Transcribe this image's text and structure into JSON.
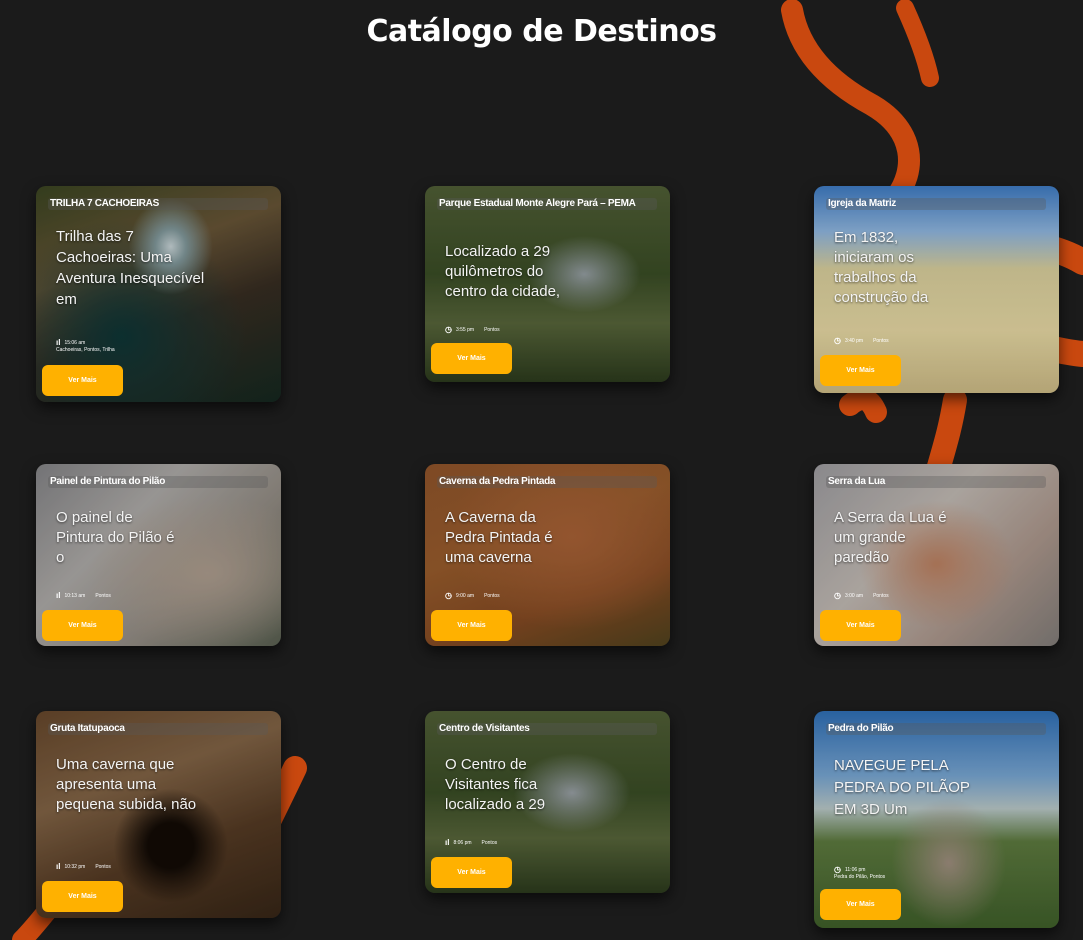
{
  "page": {
    "title": "Catálogo de Destinos"
  },
  "colors": {
    "background": "#1b1b1b",
    "accent_orange": "#c9480f",
    "button": "#ffb100"
  },
  "cards": [
    {
      "title": "TRILHA 7 CACHOEIRAS",
      "description": "Trilha das 7 Cachoeiras: Uma Aventura Inesquecível em",
      "meta_time": "15:06 am",
      "meta_tags": "Cachoeiras, Pontos, Trilha",
      "button": "Ver Mais",
      "icon": "hiker-icon"
    },
    {
      "title": "Parque Estadual Monte Alegre Pará – PEMA",
      "description": "Localizado a 29 quilômetros do centro da cidade,",
      "meta_time": "3:55 pm",
      "meta_tags": "Pontos",
      "button": "Ver Mais",
      "icon": "clock-icon"
    },
    {
      "title": "Igreja da Matriz",
      "description": "Em 1832, iniciaram os trabalhos da construção da",
      "meta_time": "3:40 pm",
      "meta_tags": "Pontos",
      "button": "Ver Mais",
      "icon": "clock-icon"
    },
    {
      "title": "Painel de Pintura do Pilão",
      "description": "O painel de Pintura do Pilão é o",
      "meta_time": "10:13 am",
      "meta_tags": "Pontos",
      "button": "Ver Mais",
      "icon": "hiker-icon"
    },
    {
      "title": "Caverna da Pedra Pintada",
      "description": "A Caverna da Pedra Pintada é uma caverna",
      "meta_time": "9:00 am",
      "meta_tags": "Pontos",
      "button": "Ver Mais",
      "icon": "clock-icon"
    },
    {
      "title": "Serra da Lua",
      "description": "A Serra da Lua é um grande paredão",
      "meta_time": "3:00 am",
      "meta_tags": "Pontos",
      "button": "Ver Mais",
      "icon": "clock-icon"
    },
    {
      "title": "Gruta Itatupaoca",
      "description": "Uma caverna que apresenta uma pequena subida, não",
      "meta_time": "10:32 pm",
      "meta_tags": "Pontos",
      "button": "Ver Mais",
      "icon": "hiker-icon"
    },
    {
      "title": "Centro de Visitantes",
      "description": "O Centro de Visitantes fica localizado a 29",
      "meta_time": "8:06 pm",
      "meta_tags": "Pontos",
      "button": "Ver Mais",
      "icon": "hiker-icon"
    },
    {
      "title": "Pedra do Pilão",
      "description": "NAVEGUE PELA PEDRA DO PILÃOP EM 3D Um",
      "meta_time": "11:06 pm",
      "meta_tags": "Pedra do Pilão, Pontos",
      "button": "Ver Mais",
      "icon": "clock-icon"
    }
  ]
}
